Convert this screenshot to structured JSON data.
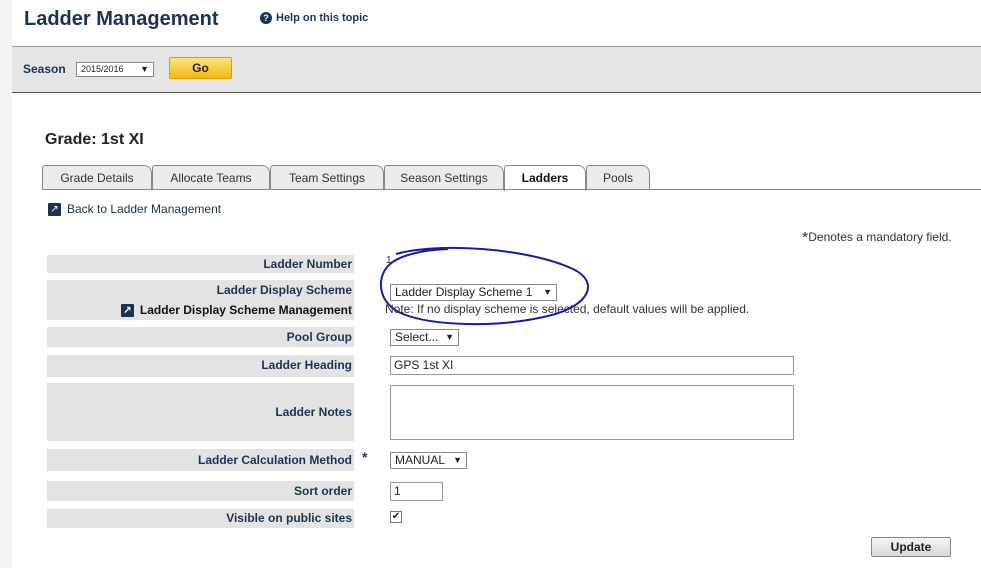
{
  "header": {
    "title": "Ladder Management",
    "help_label": "Help on this topic"
  },
  "season_bar": {
    "label": "Season",
    "selected_season": "2015/2016",
    "go_label": "Go"
  },
  "grade": {
    "title": "Grade: 1st XI"
  },
  "tabs": [
    {
      "label": "Grade Details",
      "active": false
    },
    {
      "label": "Allocate Teams",
      "active": false
    },
    {
      "label": "Team Settings",
      "active": false
    },
    {
      "label": "Season Settings",
      "active": false
    },
    {
      "label": "Ladders",
      "active": true
    },
    {
      "label": "Pools",
      "active": false
    }
  ],
  "back_link": "Back to Ladder Management",
  "mandatory_note": {
    "star": "*",
    "text": "Denotes a mandatory field."
  },
  "form": {
    "ladder_number": {
      "label": "Ladder Number",
      "value": "1"
    },
    "display_scheme": {
      "label": "Ladder Display Scheme",
      "management_link": "Ladder Display Scheme Management",
      "selected": "Ladder Display Scheme 1",
      "note": "Note: If no display scheme is selected, default values will be applied."
    },
    "pool_group": {
      "label": "Pool Group",
      "selected": "Select..."
    },
    "ladder_heading": {
      "label": "Ladder Heading",
      "value": "GPS 1st XI"
    },
    "ladder_notes": {
      "label": "Ladder Notes",
      "value": ""
    },
    "calc_method": {
      "label": "Ladder Calculation Method",
      "required_star": "*",
      "selected": "MANUAL"
    },
    "sort_order": {
      "label": "Sort order",
      "value": "1"
    },
    "visible": {
      "label": "Visible on public sites",
      "checked": true,
      "check_glyph": "✔"
    }
  },
  "update_label": "Update",
  "annotation_color": "#1a1aa8"
}
